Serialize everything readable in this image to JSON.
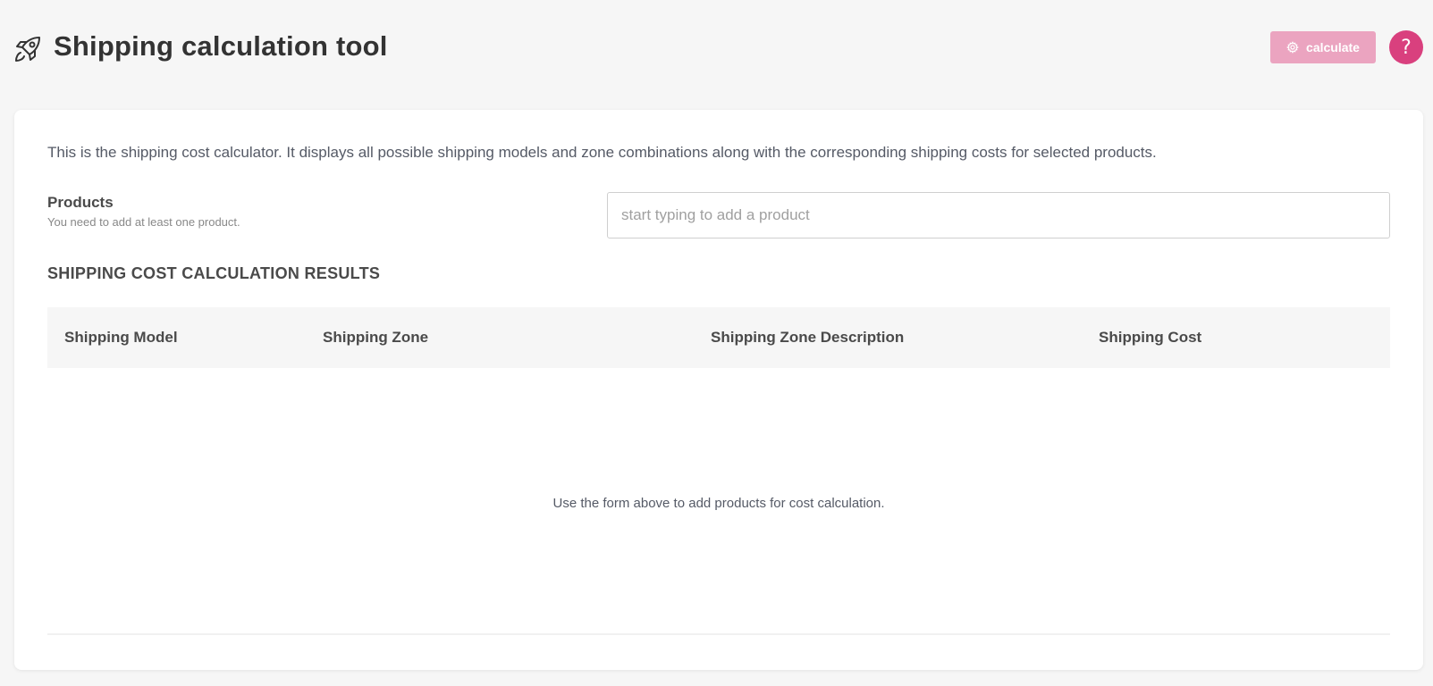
{
  "header": {
    "title": "Shipping calculation tool",
    "icon": "rocket-icon",
    "calculate_label": "calculate",
    "calculate_icon": "gear-icon",
    "help_label": "?",
    "accent_color": "#d9407e",
    "button_disabled_color": "#eba4c0"
  },
  "card": {
    "intro": "This is the shipping cost calculator. It displays all possible shipping models and zone combinations along with the corresponding shipping costs for selected products.",
    "products": {
      "label": "Products",
      "hint": "You need to add at least one product.",
      "placeholder": "start typing to add a product",
      "value": ""
    },
    "results": {
      "heading": "SHIPPING COST CALCULATION RESULTS",
      "columns": [
        "Shipping Model",
        "Shipping Zone",
        "Shipping Zone Description",
        "Shipping Cost"
      ],
      "rows": [],
      "empty_message": "Use the form above to add products for cost calculation."
    }
  }
}
